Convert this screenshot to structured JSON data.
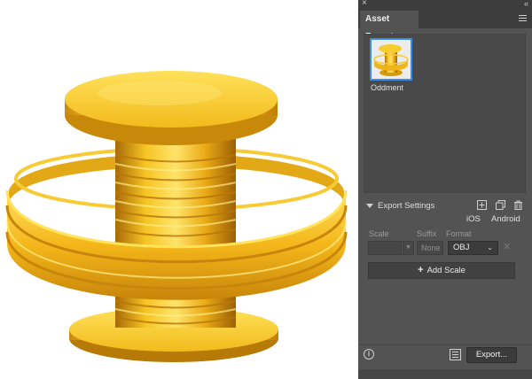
{
  "window": {
    "close_glyph": "×",
    "collapse_glyph": "«"
  },
  "panel": {
    "tab_title": "Asset Export",
    "menu_icon": "hamburger-menu-icon"
  },
  "assets": [
    {
      "label": "Oddment",
      "selected": true
    }
  ],
  "export_settings": {
    "title": "Export Settings",
    "icons": [
      "add-export-settings-icon",
      "duplicate-icon",
      "trash-icon"
    ],
    "platforms": [
      "iOS",
      "Android"
    ],
    "columns": {
      "scale": "Scale",
      "suffix": "Suffix",
      "format": "Format"
    },
    "row": {
      "scale_value": "",
      "suffix_placeholder": "None",
      "format_value": "OBJ"
    },
    "add_scale_label": "Add Scale"
  },
  "footer": {
    "export_label": "Export..."
  },
  "colors": {
    "panel_bg": "#535353",
    "selection_blue": "#3a8ee6",
    "object_gold": "#f2c21b"
  }
}
